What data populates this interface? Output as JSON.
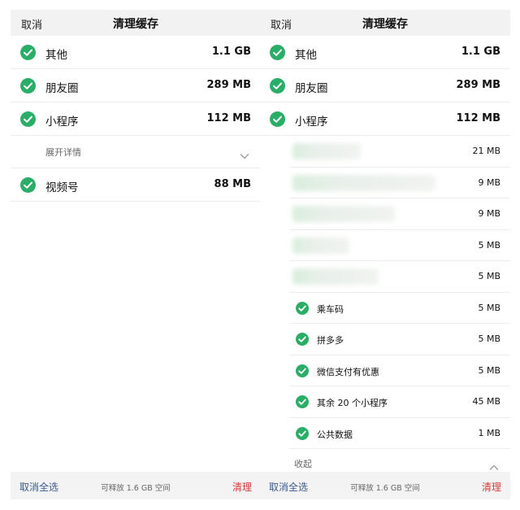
{
  "left": {
    "cancel": "取消",
    "title": "清理缓存",
    "rows": [
      {
        "label": "其他",
        "size": "1.1 GB"
      },
      {
        "label": "朋友圈",
        "size": "289 MB"
      },
      {
        "label": "小程序",
        "size": "112 MB"
      }
    ],
    "expand_label": "展开详情",
    "rows_after": [
      {
        "label": "视频号",
        "size": "88 MB"
      }
    ],
    "footer": {
      "select_all": "取消全选",
      "free": "可释放 1.6 GB 空间",
      "clean": "清理"
    }
  },
  "right": {
    "cancel": "取消",
    "title": "清理缓存",
    "rows": [
      {
        "label": "其他",
        "size": "1.1 GB"
      },
      {
        "label": "朋友圈",
        "size": "289 MB"
      },
      {
        "label": "小程序",
        "size": "112 MB"
      }
    ],
    "blurred_sizes": [
      "21 MB",
      "9 MB",
      "9 MB",
      "5 MB",
      "5 MB"
    ],
    "subitems": [
      {
        "label": "乘车码",
        "size": "5 MB"
      },
      {
        "label": "拼多多",
        "size": "5 MB"
      },
      {
        "label": "微信支付有优惠",
        "size": "5 MB"
      },
      {
        "label": "其余 20 个小程序",
        "size": "45 MB"
      },
      {
        "label": "公共数据",
        "size": "1 MB"
      }
    ],
    "collapse_label": "收起",
    "footer": {
      "select_all": "取消全选",
      "free": "可释放 1.6 GB 空间",
      "clean": "清理"
    }
  },
  "colors": {
    "check": "#2aae67",
    "clean": "#d33a3a",
    "select_all": "#3a5a8c"
  }
}
